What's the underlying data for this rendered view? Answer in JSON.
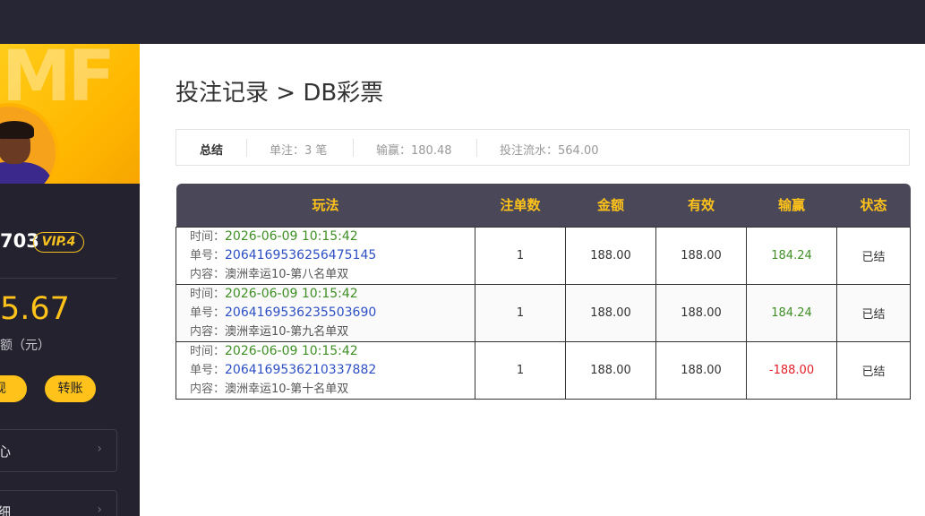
{
  "sidebar": {
    "banner_text": "MF",
    "uid_suffix": "703",
    "vip": "VIP.4",
    "balance": "5.67",
    "balance_label": "额（元）",
    "withdraw_label": "现",
    "transfer_label": "转账",
    "menu": [
      {
        "label": "心",
        "chevron": "›"
      },
      {
        "label": "细",
        "chevron": "›"
      }
    ]
  },
  "main": {
    "title": "投注记录 > DB彩票",
    "summary": {
      "title": "总结",
      "bets": "单注：3 笔",
      "winloss": "输赢：180.48",
      "turnover": "投注流水：564.00"
    },
    "table": {
      "headers": [
        "玩法",
        "注单数",
        "金额",
        "有效",
        "输赢",
        "状态"
      ],
      "labels": {
        "time": "时间：",
        "order": "单号：",
        "content": "内容："
      },
      "rows": [
        {
          "time": "2026-06-09 10:15:42",
          "order": "2064169536256475145",
          "content": "澳洲幸运10-第八名单双",
          "count": "1",
          "amount": "188.00",
          "valid": "188.00",
          "winloss": "184.24",
          "status": "已结"
        },
        {
          "time": "2026-06-09 10:15:42",
          "order": "2064169536235503690",
          "content": "澳洲幸运10-第九名单双",
          "count": "1",
          "amount": "188.00",
          "valid": "188.00",
          "winloss": "184.24",
          "status": "已结"
        },
        {
          "time": "2026-06-09 10:15:42",
          "order": "2064169536210337882",
          "content": "澳洲幸运10-第十名单双",
          "count": "1",
          "amount": "188.00",
          "valid": "188.00",
          "winloss": "-188.00",
          "status": "已结"
        }
      ]
    }
  },
  "colors": {
    "accent": "#ffc21a",
    "topbar": "#272635",
    "sidebar": "#23222e",
    "table_header": "#4a4858",
    "win": "#3f8f25",
    "loss": "#e0202a",
    "order_link": "#2e4fc4"
  }
}
